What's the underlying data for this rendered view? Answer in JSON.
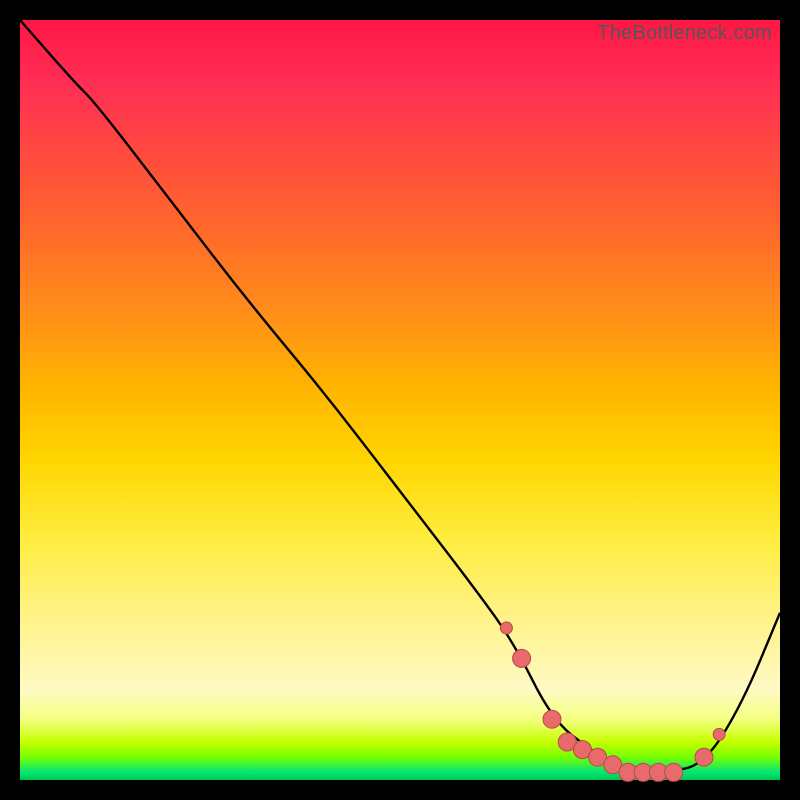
{
  "watermark": "TheBottleneck.com",
  "colors": {
    "curve_stroke": "#000000",
    "marker_fill": "#e96a6a",
    "marker_stroke": "#b54a4a",
    "background": "#000000"
  },
  "chart_data": {
    "type": "line",
    "title": "",
    "xlabel": "",
    "ylabel": "",
    "xlim": [
      0,
      100
    ],
    "ylim": [
      0,
      100
    ],
    "grid": false,
    "legend": false,
    "gradient_stops": [
      {
        "pos": 0,
        "y": 100,
        "color": "#ff1744"
      },
      {
        "pos": 50,
        "y": 50,
        "color": "#ffd600"
      },
      {
        "pos": 95,
        "y": 5,
        "color": "#c6ff00"
      },
      {
        "pos": 100,
        "y": 0,
        "color": "#00c853"
      }
    ],
    "series": [
      {
        "name": "bottleneck-curve",
        "x": [
          0,
          7,
          10,
          20,
          30,
          40,
          50,
          60,
          65,
          70,
          75,
          80,
          85,
          90,
          95,
          100
        ],
        "y": [
          100,
          92,
          89,
          76,
          63,
          51,
          38,
          25,
          18,
          8,
          4,
          1,
          1,
          2,
          10,
          22
        ]
      }
    ],
    "markers": {
      "name": "highlight-points",
      "x": [
        64,
        66,
        70,
        72,
        74,
        76,
        78,
        80,
        82,
        84,
        86,
        90,
        92
      ],
      "y": [
        20,
        16,
        8,
        5,
        4,
        3,
        2,
        1,
        1,
        1,
        1,
        3,
        6
      ]
    }
  }
}
